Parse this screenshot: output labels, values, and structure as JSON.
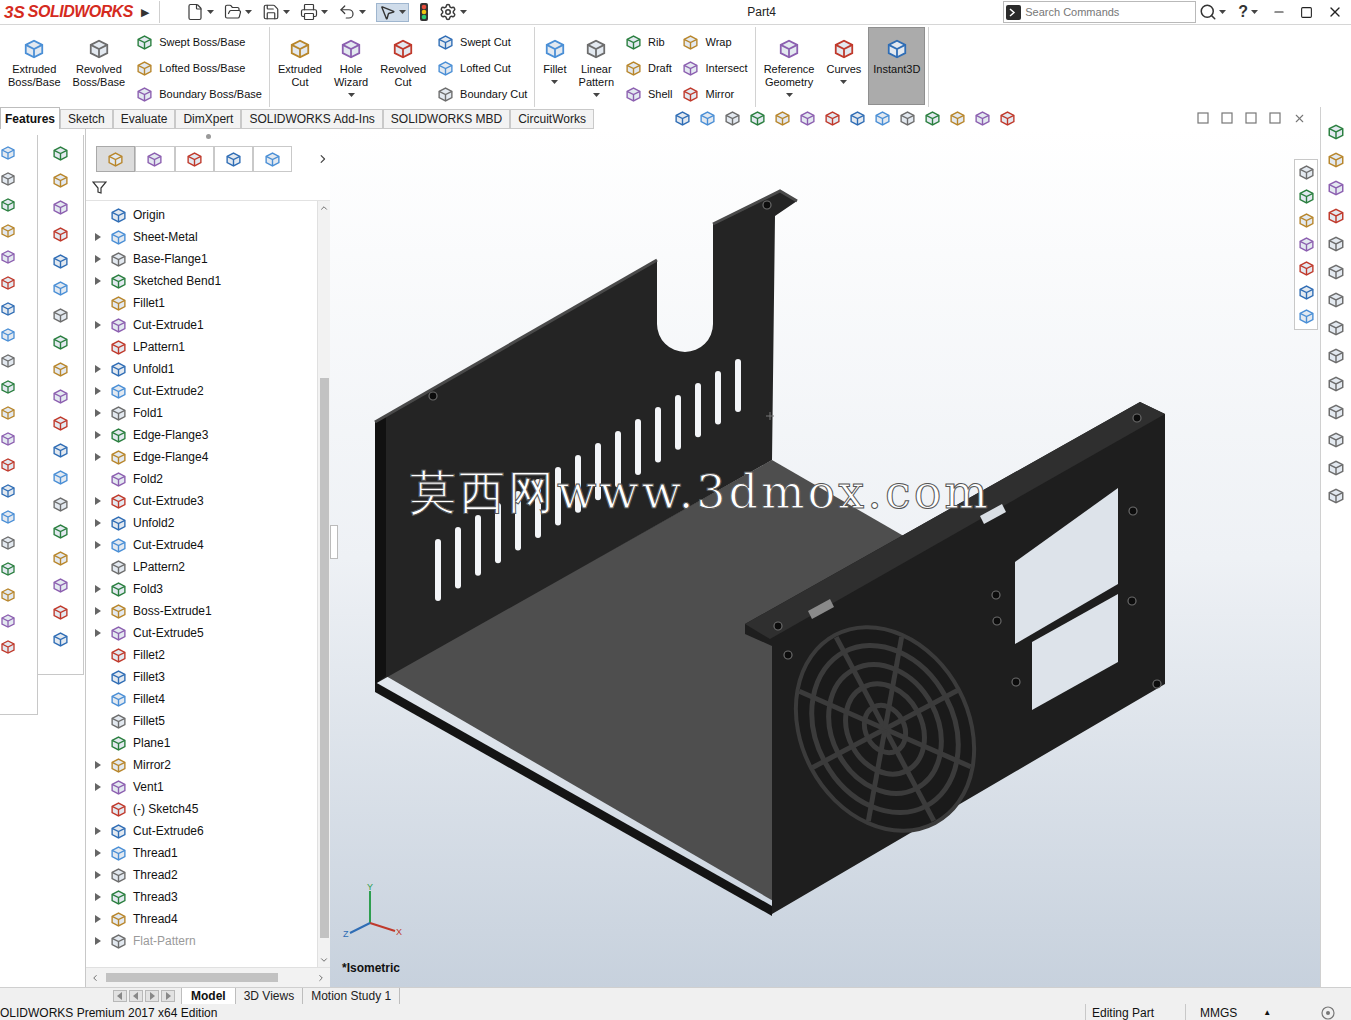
{
  "title_bar": {
    "logo_mark": "3S",
    "logo_text": "SOLIDWORKS",
    "expand": "▶",
    "document": "Part4",
    "search_placeholder": "Search Commands",
    "help": "?"
  },
  "ribbon": {
    "groups": [
      {
        "items": [
          {
            "kind": "large",
            "lines": [
              "Extruded",
              "Boss/Base"
            ],
            "dropdown": false,
            "selected": false
          },
          {
            "kind": "large",
            "lines": [
              "Revolved",
              "Boss/Base"
            ],
            "dropdown": false,
            "selected": false
          },
          {
            "kind": "stack",
            "entries": [
              "Swept Boss/Base",
              "Lofted Boss/Base",
              "Boundary Boss/Base"
            ]
          }
        ]
      },
      {
        "items": [
          {
            "kind": "large",
            "lines": [
              "Extruded",
              "Cut"
            ],
            "dropdown": false,
            "selected": false
          },
          {
            "kind": "large",
            "lines": [
              "Hole",
              "Wizard"
            ],
            "dropdown": true,
            "selected": false
          },
          {
            "kind": "large",
            "lines": [
              "Revolved",
              "Cut"
            ],
            "dropdown": false,
            "selected": false
          },
          {
            "kind": "stack",
            "entries": [
              "Swept Cut",
              "Lofted Cut",
              "Boundary Cut"
            ]
          }
        ]
      },
      {
        "items": [
          {
            "kind": "large",
            "lines": [
              "Fillet"
            ],
            "dropdown": true,
            "selected": false
          },
          {
            "kind": "large",
            "lines": [
              "Linear",
              "Pattern"
            ],
            "dropdown": true,
            "selected": false
          },
          {
            "kind": "stack",
            "entries": [
              "Rib",
              "Draft",
              "Shell"
            ]
          },
          {
            "kind": "stack",
            "entries": [
              "Wrap",
              "Intersect",
              "Mirror"
            ]
          }
        ]
      },
      {
        "items": [
          {
            "kind": "large",
            "lines": [
              "Reference",
              "Geometry"
            ],
            "dropdown": true,
            "selected": false
          },
          {
            "kind": "large",
            "lines": [
              "Curves"
            ],
            "dropdown": true,
            "selected": false
          },
          {
            "kind": "large",
            "lines": [
              "Instant3D"
            ],
            "dropdown": false,
            "selected": true
          }
        ]
      }
    ]
  },
  "command_tabs": [
    {
      "label": "Features",
      "selected": true
    },
    {
      "label": "Sketch",
      "selected": false
    },
    {
      "label": "Evaluate",
      "selected": false
    },
    {
      "label": "DimXpert",
      "selected": false
    },
    {
      "label": "SOLIDWORKS Add-Ins",
      "selected": false
    },
    {
      "label": "SOLIDWORKS MBD",
      "selected": false
    },
    {
      "label": "CircuitWorks",
      "selected": false
    }
  ],
  "tree": {
    "items": [
      {
        "label": "Origin",
        "expandable": false,
        "disabled": false
      },
      {
        "label": "Sheet-Metal",
        "expandable": true,
        "disabled": false
      },
      {
        "label": "Base-Flange1",
        "expandable": true,
        "disabled": false
      },
      {
        "label": "Sketched Bend1",
        "expandable": true,
        "disabled": false
      },
      {
        "label": "Fillet1",
        "expandable": false,
        "disabled": false
      },
      {
        "label": "Cut-Extrude1",
        "expandable": true,
        "disabled": false
      },
      {
        "label": "LPattern1",
        "expandable": false,
        "disabled": false
      },
      {
        "label": "Unfold1",
        "expandable": true,
        "disabled": false
      },
      {
        "label": "Cut-Extrude2",
        "expandable": true,
        "disabled": false
      },
      {
        "label": "Fold1",
        "expandable": true,
        "disabled": false
      },
      {
        "label": "Edge-Flange3",
        "expandable": true,
        "disabled": false
      },
      {
        "label": "Edge-Flange4",
        "expandable": true,
        "disabled": false
      },
      {
        "label": "Fold2",
        "expandable": false,
        "disabled": false
      },
      {
        "label": "Cut-Extrude3",
        "expandable": true,
        "disabled": false
      },
      {
        "label": "Unfold2",
        "expandable": true,
        "disabled": false
      },
      {
        "label": "Cut-Extrude4",
        "expandable": true,
        "disabled": false
      },
      {
        "label": "LPattern2",
        "expandable": false,
        "disabled": false
      },
      {
        "label": "Fold3",
        "expandable": true,
        "disabled": false
      },
      {
        "label": "Boss-Extrude1",
        "expandable": true,
        "disabled": false
      },
      {
        "label": "Cut-Extrude5",
        "expandable": true,
        "disabled": false
      },
      {
        "label": "Fillet2",
        "expandable": false,
        "disabled": false
      },
      {
        "label": "Fillet3",
        "expandable": false,
        "disabled": false
      },
      {
        "label": "Fillet4",
        "expandable": false,
        "disabled": false
      },
      {
        "label": "Fillet5",
        "expandable": false,
        "disabled": false
      },
      {
        "label": "Plane1",
        "expandable": false,
        "disabled": false
      },
      {
        "label": "Mirror2",
        "expandable": true,
        "disabled": false
      },
      {
        "label": "Vent1",
        "expandable": true,
        "disabled": false
      },
      {
        "label": "(-) Sketch45",
        "expandable": false,
        "disabled": false
      },
      {
        "label": "Cut-Extrude6",
        "expandable": true,
        "disabled": false
      },
      {
        "label": "Thread1",
        "expandable": true,
        "disabled": false
      },
      {
        "label": "Thread2",
        "expandable": true,
        "disabled": false
      },
      {
        "label": "Thread3",
        "expandable": true,
        "disabled": false
      },
      {
        "label": "Thread4",
        "expandable": true,
        "disabled": false
      },
      {
        "label": "Flat-Pattern",
        "expandable": true,
        "disabled": true
      }
    ]
  },
  "viewport": {
    "watermark": "莫西网www.3dmox.com",
    "view_label": "*Isometric",
    "triad": {
      "x": "X",
      "y": "Y",
      "z": "Z"
    }
  },
  "bottom_tabs": [
    {
      "label": "Model",
      "selected": true
    },
    {
      "label": "3D Views",
      "selected": false
    },
    {
      "label": "Motion Study 1",
      "selected": false
    }
  ],
  "status_bar": {
    "edition": "OLIDWORKS Premium 2017 x64 Edition",
    "mode": "Editing Part",
    "units": "MMGS",
    "units_arrow": "▲"
  }
}
